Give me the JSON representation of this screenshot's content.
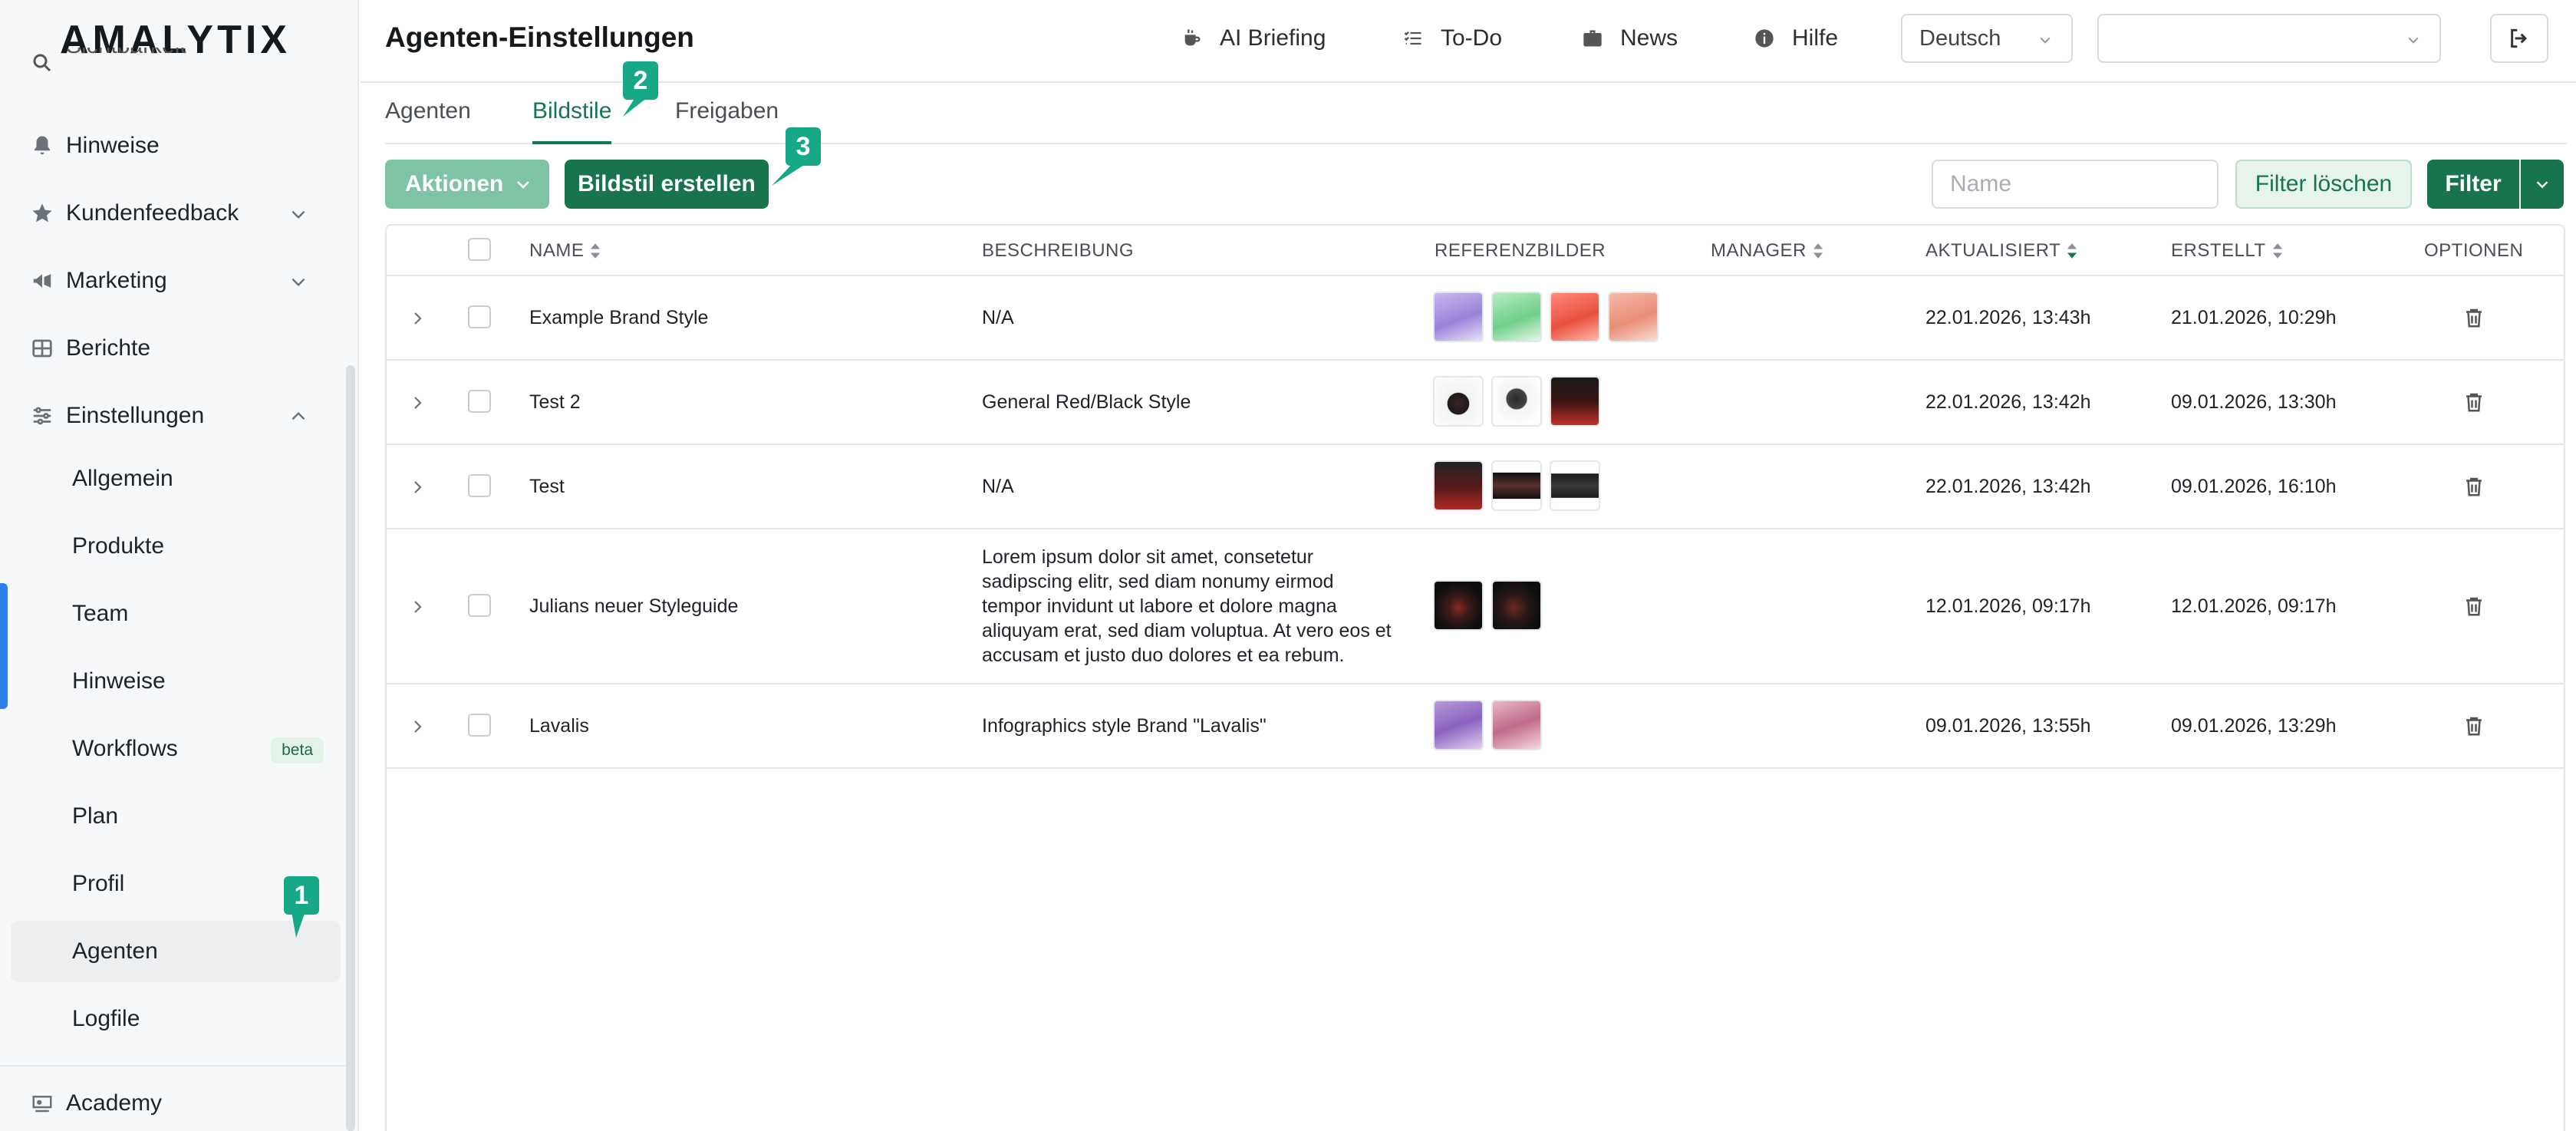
{
  "app": {
    "logo": "AMALYTIX"
  },
  "sidebar": {
    "top_partial": "Sichtbarkeit",
    "items": [
      {
        "label": "Hinweise",
        "icon": "bell-icon"
      },
      {
        "label": "Kundenfeedback",
        "icon": "star-icon"
      },
      {
        "label": "Marketing",
        "icon": "megaphone-icon"
      },
      {
        "label": "Berichte",
        "icon": "grid-icon"
      },
      {
        "label": "Einstellungen",
        "icon": "sliders-icon"
      }
    ],
    "subitems": [
      "Allgemein",
      "Produkte",
      "Team",
      "Hinweise",
      "Workflows",
      "Plan",
      "Profil",
      "Agenten",
      "Logfile"
    ],
    "workflows_badge": "beta",
    "bottom_item": {
      "label": "Academy",
      "icon": "academy-icon"
    }
  },
  "header": {
    "title": "Agenten-Einstellungen",
    "nav": [
      {
        "label": "AI Briefing",
        "icon": "coffee-icon"
      },
      {
        "label": "To-Do",
        "icon": "checklist-icon"
      },
      {
        "label": "News",
        "icon": "briefcase-icon"
      },
      {
        "label": "Hilfe",
        "icon": "info-icon"
      }
    ],
    "language": "Deutsch",
    "account": ""
  },
  "tabs": [
    "Agenten",
    "Bildstile",
    "Freigaben"
  ],
  "toolbar": {
    "actions_label": "Aktionen",
    "create_label": "Bildstil erstellen",
    "name_placeholder": "Name",
    "clear_filter_label": "Filter löschen",
    "filter_label": "Filter"
  },
  "table": {
    "columns": [
      "NAME",
      "BESCHREIBUNG",
      "REFERENZBILDER",
      "MANAGER",
      "AKTUALISIERT",
      "ERSTELLT",
      "OPTIONEN"
    ],
    "sorted_column": "AKTUALISIERT",
    "rows": [
      {
        "name": "Example Brand Style",
        "description": "N/A",
        "manager": "",
        "updated": "22.01.2026, 13:43h",
        "created": "21.01.2026, 10:29h",
        "images": 4
      },
      {
        "name": "Test 2",
        "description": "General Red/Black Style",
        "manager": "",
        "updated": "22.01.2026, 13:42h",
        "created": "09.01.2026, 13:30h",
        "images": 3
      },
      {
        "name": "Test",
        "description": "N/A",
        "manager": "",
        "updated": "22.01.2026, 13:42h",
        "created": "09.01.2026, 16:10h",
        "images": 3
      },
      {
        "name": "Julians neuer Styleguide",
        "description": "Lorem ipsum dolor sit amet, consetetur sadipscing elitr, sed diam nonumy eirmod tempor invidunt ut labore et dolore magna aliquyam erat, sed diam voluptua. At vero eos et accusam et justo duo dolores et ea rebum.",
        "manager": "",
        "updated": "12.01.2026, 09:17h",
        "created": "12.01.2026, 09:17h",
        "images": 2
      },
      {
        "name": "Lavalis",
        "description": "Infographics style Brand \"Lavalis\"",
        "manager": "",
        "updated": "09.01.2026, 13:55h",
        "created": "09.01.2026, 13:29h",
        "images": 2
      }
    ]
  },
  "markers": [
    "1",
    "2",
    "3"
  ],
  "colors": {
    "primary": "#17744c",
    "primary_light": "#7fc3a5",
    "marker": "#17a887",
    "active_tab": "#14784e",
    "sidebar_accent": "#2f80ed"
  }
}
